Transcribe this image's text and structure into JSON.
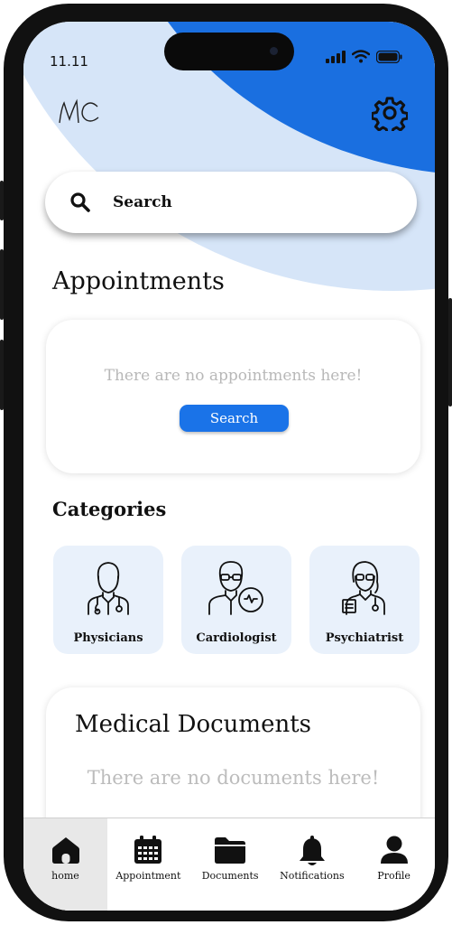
{
  "status_bar": {
    "time": "11.11"
  },
  "header": {
    "logo_text": "MC"
  },
  "search": {
    "label": "Search"
  },
  "appointments": {
    "heading": "Appointments",
    "empty_text": "There are no appointments here!",
    "search_button": "Search"
  },
  "categories": {
    "heading": "Categories",
    "items": [
      {
        "label": "Physicians",
        "icon": "doctor-icon"
      },
      {
        "label": "Cardiologist",
        "icon": "cardiologist-icon"
      },
      {
        "label": "Psychiatrist",
        "icon": "psychiatrist-icon"
      }
    ]
  },
  "documents": {
    "heading": "Medical Documents",
    "empty_text": "There are no documents here!"
  },
  "nav": {
    "items": [
      {
        "label": "home",
        "icon": "home-icon",
        "active": true
      },
      {
        "label": "Appointment",
        "icon": "calendar-icon"
      },
      {
        "label": "Documents",
        "icon": "folder-icon"
      },
      {
        "label": "Notifications",
        "icon": "bell-icon"
      },
      {
        "label": "Profile",
        "icon": "user-icon"
      }
    ]
  },
  "colors": {
    "accent": "#1a73e8",
    "header_blue": "#1a6fe0",
    "light_blue": "#d6e5f8",
    "card_bg": "#e9f1fb"
  }
}
